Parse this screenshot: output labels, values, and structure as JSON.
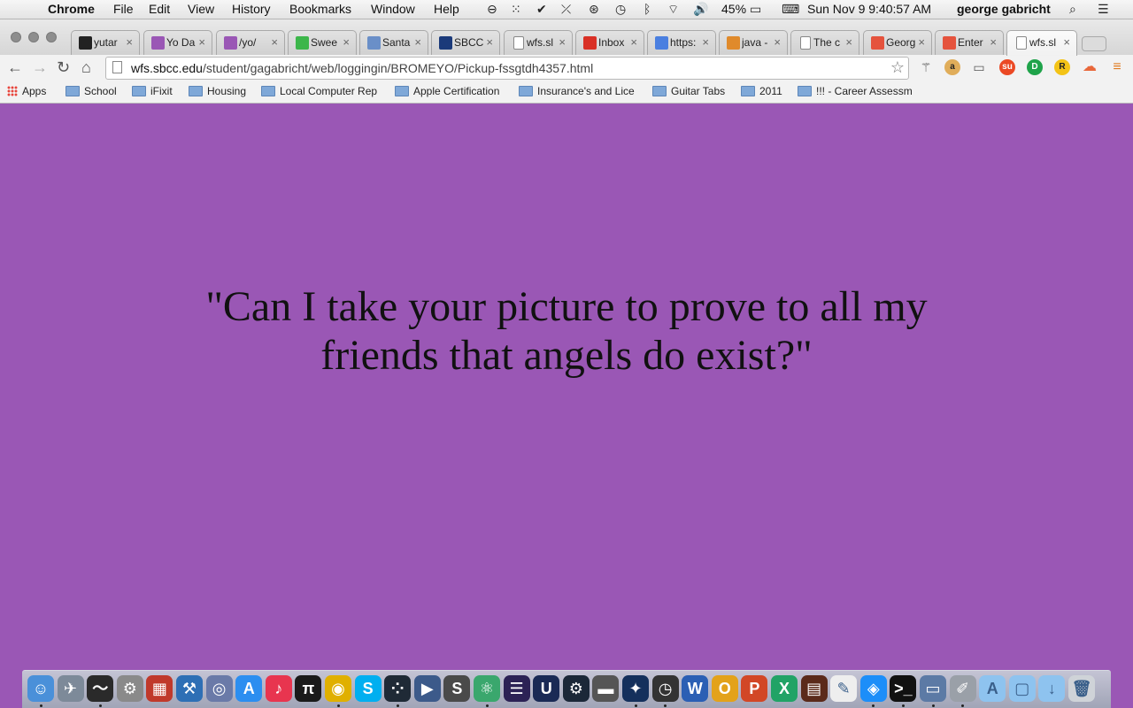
{
  "menubar": {
    "app_name": "Chrome",
    "menus": [
      "File",
      "Edit",
      "View",
      "History",
      "Bookmarks",
      "Window",
      "Help"
    ],
    "battery": "45%",
    "datetime": "Sun Nov 9  9:40:57 AM",
    "user": "george gabricht"
  },
  "tabs": [
    {
      "title": "yutar",
      "icon": "github-icon",
      "color": "#222222"
    },
    {
      "title": "Yo Da",
      "icon": "purple-square-icon",
      "color": "#9a57b5"
    },
    {
      "title": "/yo/",
      "icon": "purple-square-icon",
      "color": "#9a57b5"
    },
    {
      "title": "Swee",
      "icon": "u-green-icon",
      "color": "#3cb64a"
    },
    {
      "title": "Santa",
      "icon": "grid-icon",
      "color": "#6a8fc8"
    },
    {
      "title": "SBCC",
      "icon": "sbcc-icon",
      "color": "#1b3a7a"
    },
    {
      "title": "wfs.sl",
      "icon": "page-icon",
      "color": "#ffffff"
    },
    {
      "title": "Inbox",
      "icon": "gmail-icon",
      "color": "#d93025"
    },
    {
      "title": "https:",
      "icon": "google-icon",
      "color": "#4a7fe0"
    },
    {
      "title": "java -",
      "icon": "stackoverflow-icon",
      "color": "#e08a2b"
    },
    {
      "title": "The c",
      "icon": "page-icon",
      "color": "#ffffff"
    },
    {
      "title": "Georg",
      "icon": "pinwheel-icon",
      "color": "#e5533d"
    },
    {
      "title": "Enter",
      "icon": "pinwheel-icon",
      "color": "#e5533d"
    },
    {
      "title": "wfs.sl",
      "icon": "page-icon",
      "color": "#ffffff",
      "active": true
    }
  ],
  "omnibox": {
    "host": "wfs.sbcc.edu",
    "path": "/student/gagabricht/web/loggingin/BROMEYO/Pickup-fssgtdh4357.html"
  },
  "bookmarks": [
    "Apps",
    "School",
    "iFixit",
    "Housing",
    "Local Computer Rep",
    "Apple Certification",
    "Insurance's and Lice",
    "Guitar Tabs",
    "2011",
    "!!! - Career Assessm"
  ],
  "page": {
    "quote_line1": "\"Can I take your picture to prove to all my",
    "quote_line2": "friends that angels do exist?\""
  },
  "colors": {
    "page_background": "#9a57b5",
    "quote_text": "#111111"
  },
  "dock": [
    {
      "name": "finder-icon",
      "color": "#4a90d9",
      "glyph": "☺"
    },
    {
      "name": "launchpad-icon",
      "color": "#7d8a99",
      "glyph": "✈"
    },
    {
      "name": "activity-monitor-icon",
      "color": "#2a2a2a",
      "glyph": "〜"
    },
    {
      "name": "system-preferences-icon",
      "color": "#8a8a8a",
      "glyph": "⚙"
    },
    {
      "name": "photo-booth-icon",
      "color": "#c0392b",
      "glyph": "▦"
    },
    {
      "name": "xcode-icon",
      "color": "#2e6fb5",
      "glyph": "⚒"
    },
    {
      "name": "network-utility-icon",
      "color": "#6a7aa8",
      "glyph": "◎"
    },
    {
      "name": "app-store-icon",
      "color": "#2c8ef0",
      "glyph": "A"
    },
    {
      "name": "itunes-icon",
      "color": "#e8354f",
      "glyph": "♪"
    },
    {
      "name": "pi-icon",
      "color": "#1a1a1a",
      "glyph": "π"
    },
    {
      "name": "chrome-icon",
      "color": "#e0b000",
      "glyph": "◉"
    },
    {
      "name": "skype-icon",
      "color": "#00aff0",
      "glyph": "S"
    },
    {
      "name": "fitbit-icon",
      "color": "#1f2a36",
      "glyph": "⁘"
    },
    {
      "name": "quicktime-icon",
      "color": "#3c5a8a",
      "glyph": "▶"
    },
    {
      "name": "sublime-text-icon",
      "color": "#4a4a4a",
      "glyph": "S"
    },
    {
      "name": "atom-icon",
      "color": "#3aa76d",
      "glyph": "⚛"
    },
    {
      "name": "eclipse-icon",
      "color": "#2c2255",
      "glyph": "☰"
    },
    {
      "name": "unreal-icon",
      "color": "#1a2a55",
      "glyph": "U"
    },
    {
      "name": "steam-icon",
      "color": "#1b2838",
      "glyph": "⚙"
    },
    {
      "name": "drive-icon",
      "color": "#555555",
      "glyph": "▬"
    },
    {
      "name": "battlenet-icon",
      "color": "#14305c",
      "glyph": "✦"
    },
    {
      "name": "screenshot-icon",
      "color": "#333333",
      "glyph": "◷"
    },
    {
      "name": "word-icon",
      "color": "#2b5fb4",
      "glyph": "W"
    },
    {
      "name": "outlook-icon",
      "color": "#e3a21a",
      "glyph": "O"
    },
    {
      "name": "powerpoint-icon",
      "color": "#d24726",
      "glyph": "P"
    },
    {
      "name": "excel-icon",
      "color": "#21a366",
      "glyph": "X"
    },
    {
      "name": "notebook-icon",
      "color": "#5b2a1a",
      "glyph": "▤"
    },
    {
      "name": "textedit-icon",
      "color": "#eeeeee",
      "glyph": "✎"
    },
    {
      "name": "safari-icon",
      "color": "#1c8ef9",
      "glyph": "◈"
    },
    {
      "name": "terminal-icon",
      "color": "#111111",
      "glyph": ">_"
    },
    {
      "name": "preview-icon",
      "color": "#5c7aa5",
      "glyph": "▭"
    },
    {
      "name": "script-editor-icon",
      "color": "#9aa0a8",
      "glyph": "✐"
    },
    {
      "name": "applications-folder-icon",
      "color": "#8ec3ef",
      "glyph": "A"
    },
    {
      "name": "documents-folder-icon",
      "color": "#8ec3ef",
      "glyph": "▢"
    },
    {
      "name": "downloads-folder-icon",
      "color": "#8ec3ef",
      "glyph": "↓"
    },
    {
      "name": "trash-icon",
      "color": "#cfd3d8",
      "glyph": "🗑"
    }
  ]
}
